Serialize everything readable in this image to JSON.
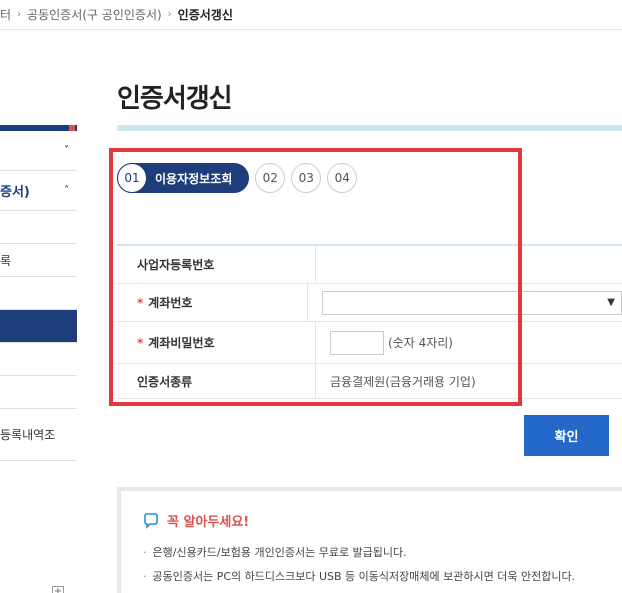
{
  "breadcrumb": {
    "items": [
      "터",
      "공동인증서(구 공인인증서)",
      "인증서갱신"
    ]
  },
  "sidebar": {
    "items": [
      {
        "label": "",
        "chevron": "˅"
      },
      {
        "label": "증서)",
        "chevron": "˄"
      },
      {
        "label": ""
      },
      {
        "label": "록"
      },
      {
        "label": ""
      },
      {
        "label": ""
      },
      {
        "label": ""
      },
      {
        "label": ""
      },
      {
        "label": "등록내역조"
      },
      {
        "label": "+"
      }
    ]
  },
  "page": {
    "title": "인증서갱신"
  },
  "steps": {
    "active_num": "01",
    "active_label": "이용자정보조회",
    "others": [
      "02",
      "03",
      "04"
    ]
  },
  "form": {
    "rows": [
      {
        "label": "사업자등록번호",
        "required": false,
        "value": ""
      },
      {
        "label": "계좌번호",
        "required": true,
        "value": ""
      },
      {
        "label": "계좌비밀번호",
        "required": true,
        "hint": "(숫자 4자리)"
      },
      {
        "label": "인증서종류",
        "required": false,
        "value": "금융결제원(금융거래용 기업)"
      }
    ],
    "required_mark": "*"
  },
  "actions": {
    "confirm_label": "확인"
  },
  "notice": {
    "title": "꼭 알아두세요!",
    "items": [
      "은행/신용카드/보험용 개인인증서는 무료로 발급됩니다.",
      "공동인증서는 PC의 하드디스크보다 USB 등 이동식저장매체에 보관하시면 더욱 안전합니다."
    ]
  },
  "colors": {
    "navy": "#1e3d7b",
    "accent_blue": "#2468c9",
    "highlight_red": "#e0393e",
    "light_blue_bar": "#cfe6f0"
  }
}
